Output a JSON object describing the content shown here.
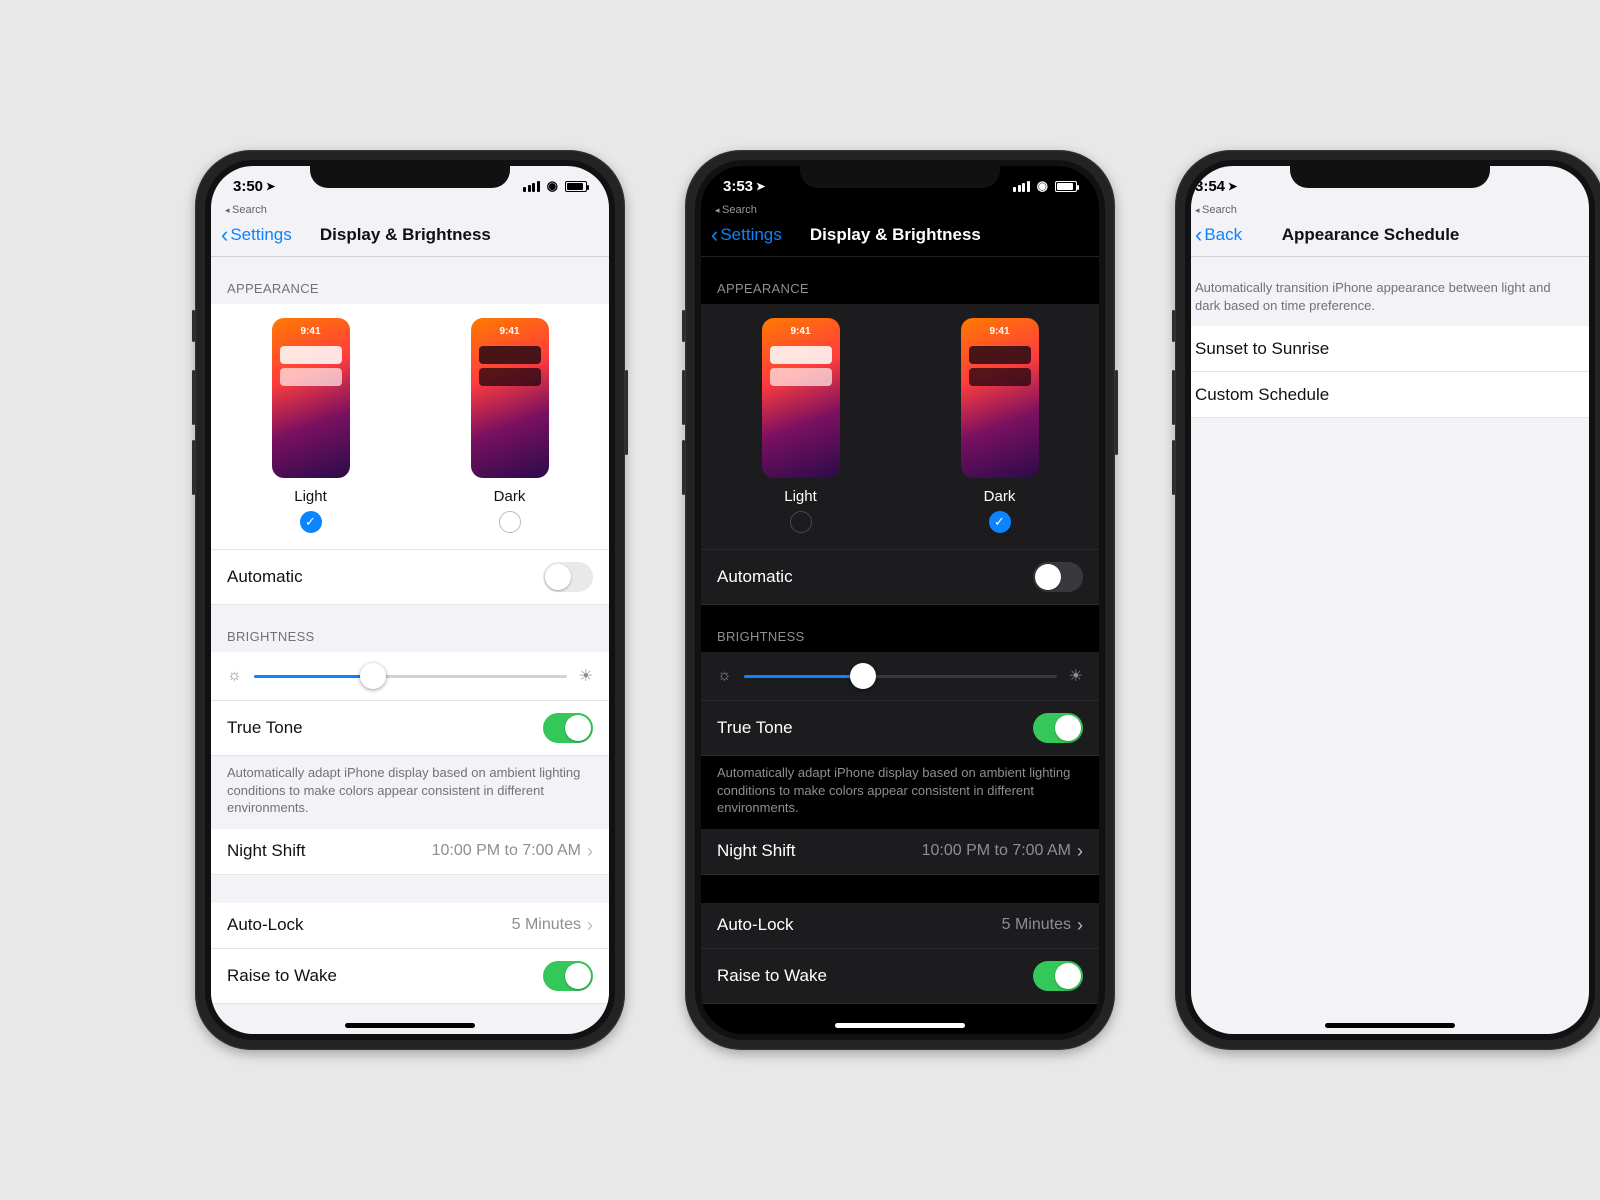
{
  "shared": {
    "thumb_time": "9:41",
    "appearance_header": "APPEARANCE",
    "brightness_header": "BRIGHTNESS",
    "light_label": "Light",
    "dark_label": "Dark",
    "automatic_label": "Automatic",
    "truetone_label": "True Tone",
    "truetone_footer": "Automatically adapt iPhone display based on ambient lighting conditions to make colors appear consistent in different environments.",
    "nightshift_label": "Night Shift",
    "nightshift_detail": "10:00 PM to 7:00 AM",
    "autolock_label": "Auto-Lock",
    "autolock_detail": "5 Minutes",
    "raise_label": "Raise to Wake"
  },
  "p1": {
    "time": "3:50",
    "breadcrumb": "Search",
    "back": "Settings",
    "title": "Display & Brightness"
  },
  "p2": {
    "time": "3:53",
    "breadcrumb": "Search",
    "back": "Settings",
    "title": "Display & Brightness"
  },
  "p3": {
    "time": "3:54",
    "breadcrumb": "Search",
    "back": "Back",
    "title": "Appearance Schedule",
    "desc": "Automatically transition iPhone appearance between light and dark based on time preference.",
    "opt1": "Sunset to Sunrise",
    "opt2": "Custom Schedule"
  }
}
